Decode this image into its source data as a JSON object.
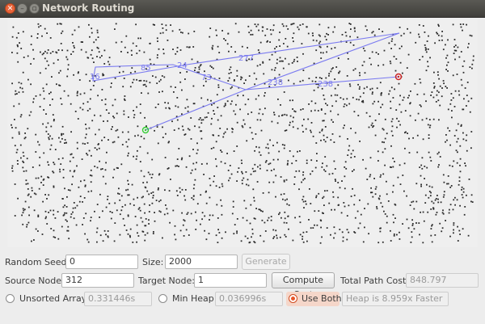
{
  "window": {
    "title": "Network Routing"
  },
  "graph": {
    "edge_labels": [
      "16",
      "85",
      "24",
      "73",
      "277",
      "238",
      "238"
    ],
    "colors": {
      "edge": "#7a7af0",
      "node": "#2b2b2b",
      "source": "#33cc33",
      "target": "#cc2222"
    }
  },
  "controls": {
    "random_seed_label": "Random Seed:",
    "random_seed_value": "0",
    "size_label": "Size:",
    "size_value": "2000",
    "generate_label": "Generate",
    "source_node_label": "Source Node:",
    "source_node_value": "312",
    "target_node_label": "Target Node:",
    "target_node_value": "1",
    "compute_cost_label": "Compute Cost",
    "total_path_cost_label": "Total Path Cost:",
    "total_path_cost_value": "848.797",
    "unsorted_array_label": "Unsorted Array",
    "unsorted_array_time": "0.331446s",
    "min_heap_label": "Min Heap",
    "min_heap_time": "0.036996s",
    "use_both_label": "Use Both",
    "use_both_result": "Heap is 8.959x Faster",
    "selected_mode": "use_both"
  }
}
